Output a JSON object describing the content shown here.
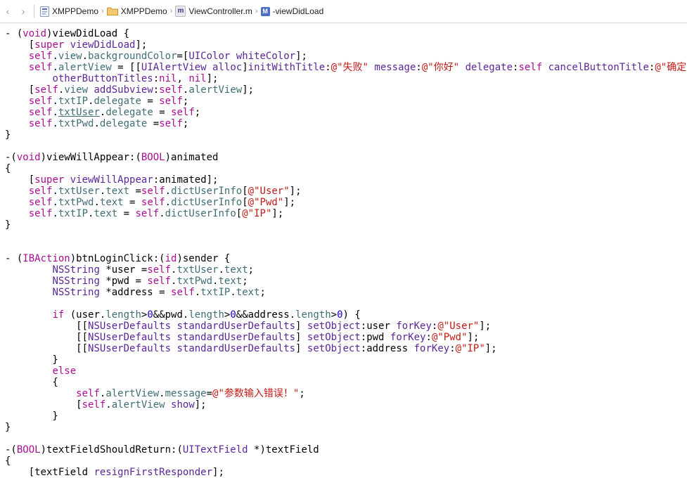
{
  "jumpbar": {
    "back_glyph": "‹",
    "forward_glyph": "›",
    "crumbs": [
      {
        "label": "XMPPDemo",
        "icon": "project-icon"
      },
      {
        "label": "XMPPDemo",
        "icon": "folder-icon"
      },
      {
        "label": "ViewController.m",
        "icon": "objc-file-icon",
        "glyph": "m"
      },
      {
        "label": "-viewDidLoad",
        "icon": "method-icon",
        "glyph": "M"
      }
    ]
  },
  "colors": {
    "keyword": "#aa0d91",
    "class": "#5c2699",
    "property": "#3f6e74",
    "string": "#c41a16",
    "number": "#1c00cf"
  },
  "code": {
    "lines": [
      [
        [
          "t",
          "- ("
        ],
        [
          "kw",
          "void"
        ],
        [
          "t",
          ")viewDidLoad {"
        ]
      ],
      [
        [
          "t",
          "    ["
        ],
        [
          "kw",
          "super"
        ],
        [
          "t",
          " "
        ],
        [
          "cls",
          "viewDidLoad"
        ],
        [
          "t",
          "];"
        ]
      ],
      [
        [
          "t",
          "    "
        ],
        [
          "kw",
          "self"
        ],
        [
          "t",
          "."
        ],
        [
          "prop",
          "view"
        ],
        [
          "t",
          "."
        ],
        [
          "prop",
          "backgroundColor"
        ],
        [
          "t",
          "=["
        ],
        [
          "cls",
          "UIColor"
        ],
        [
          "t",
          " "
        ],
        [
          "cls",
          "whiteColor"
        ],
        [
          "t",
          "];"
        ]
      ],
      [
        [
          "t",
          "    "
        ],
        [
          "kw",
          "self"
        ],
        [
          "t",
          "."
        ],
        [
          "prop",
          "alertView"
        ],
        [
          "t",
          " = [["
        ],
        [
          "cls",
          "UIAlertView"
        ],
        [
          "t",
          " "
        ],
        [
          "cls",
          "alloc"
        ],
        [
          "t",
          "]"
        ],
        [
          "cls",
          "initWithTitle"
        ],
        [
          "t",
          ":"
        ],
        [
          "str",
          "@\"失败\""
        ],
        [
          "t",
          " "
        ],
        [
          "cls",
          "message"
        ],
        [
          "t",
          ":"
        ],
        [
          "str",
          "@\"你好\""
        ],
        [
          "t",
          " "
        ],
        [
          "cls",
          "delegate"
        ],
        [
          "t",
          ":"
        ],
        [
          "kw",
          "self"
        ],
        [
          "t",
          " "
        ],
        [
          "cls",
          "cancelButtonTitle"
        ],
        [
          "t",
          ":"
        ],
        [
          "str",
          "@\"确定\""
        ]
      ],
      [
        [
          "t",
          "        "
        ],
        [
          "cls",
          "otherButtonTitles"
        ],
        [
          "t",
          ":"
        ],
        [
          "kw",
          "nil"
        ],
        [
          "t",
          ", "
        ],
        [
          "kw",
          "nil"
        ],
        [
          "t",
          "];"
        ]
      ],
      [
        [
          "t",
          "    ["
        ],
        [
          "kw",
          "self"
        ],
        [
          "t",
          "."
        ],
        [
          "prop",
          "view"
        ],
        [
          "t",
          " "
        ],
        [
          "cls",
          "addSubview"
        ],
        [
          "t",
          ":"
        ],
        [
          "kw",
          "self"
        ],
        [
          "t",
          "."
        ],
        [
          "prop",
          "alertView"
        ],
        [
          "t",
          "];"
        ]
      ],
      [
        [
          "t",
          "    "
        ],
        [
          "kw",
          "self"
        ],
        [
          "t",
          "."
        ],
        [
          "prop",
          "txtIP"
        ],
        [
          "t",
          "."
        ],
        [
          "prop",
          "delegate"
        ],
        [
          "t",
          " = "
        ],
        [
          "kw",
          "self"
        ],
        [
          "t",
          ";"
        ]
      ],
      [
        [
          "t",
          "    "
        ],
        [
          "kw",
          "self"
        ],
        [
          "t",
          "."
        ],
        [
          "propu",
          "txtUser"
        ],
        [
          "t",
          "."
        ],
        [
          "prop",
          "delegate"
        ],
        [
          "t",
          " = "
        ],
        [
          "kw",
          "self"
        ],
        [
          "t",
          ";"
        ]
      ],
      [
        [
          "t",
          "    "
        ],
        [
          "kw",
          "self"
        ],
        [
          "t",
          "."
        ],
        [
          "prop",
          "txtPwd"
        ],
        [
          "t",
          "."
        ],
        [
          "prop",
          "delegate"
        ],
        [
          "t",
          " ="
        ],
        [
          "kw",
          "self"
        ],
        [
          "t",
          ";"
        ]
      ],
      [
        [
          "t",
          "}"
        ]
      ],
      [],
      [
        [
          "t",
          "-("
        ],
        [
          "kw",
          "void"
        ],
        [
          "t",
          ")viewWillAppear:("
        ],
        [
          "kw",
          "BOOL"
        ],
        [
          "t",
          ")animated"
        ]
      ],
      [
        [
          "t",
          "{"
        ]
      ],
      [
        [
          "t",
          "    ["
        ],
        [
          "kw",
          "super"
        ],
        [
          "t",
          " "
        ],
        [
          "cls",
          "viewWillAppear"
        ],
        [
          "t",
          ":animated];"
        ]
      ],
      [
        [
          "t",
          "    "
        ],
        [
          "kw",
          "self"
        ],
        [
          "t",
          "."
        ],
        [
          "prop",
          "txtUser"
        ],
        [
          "t",
          "."
        ],
        [
          "prop",
          "text"
        ],
        [
          "t",
          " ="
        ],
        [
          "kw",
          "self"
        ],
        [
          "t",
          "."
        ],
        [
          "prop",
          "dictUserInfo"
        ],
        [
          "t",
          "["
        ],
        [
          "str",
          "@\"User\""
        ],
        [
          "t",
          "];"
        ]
      ],
      [
        [
          "t",
          "    "
        ],
        [
          "kw",
          "self"
        ],
        [
          "t",
          "."
        ],
        [
          "prop",
          "txtPwd"
        ],
        [
          "t",
          "."
        ],
        [
          "prop",
          "text"
        ],
        [
          "t",
          " = "
        ],
        [
          "kw",
          "self"
        ],
        [
          "t",
          "."
        ],
        [
          "prop",
          "dictUserInfo"
        ],
        [
          "t",
          "["
        ],
        [
          "str",
          "@\"Pwd\""
        ],
        [
          "t",
          "];"
        ]
      ],
      [
        [
          "t",
          "    "
        ],
        [
          "kw",
          "self"
        ],
        [
          "t",
          "."
        ],
        [
          "prop",
          "txtIP"
        ],
        [
          "t",
          "."
        ],
        [
          "prop",
          "text"
        ],
        [
          "t",
          " = "
        ],
        [
          "kw",
          "self"
        ],
        [
          "t",
          "."
        ],
        [
          "prop",
          "dictUserInfo"
        ],
        [
          "t",
          "["
        ],
        [
          "str",
          "@\"IP\""
        ],
        [
          "t",
          "];"
        ]
      ],
      [
        [
          "t",
          "}"
        ]
      ],
      [],
      [],
      [
        [
          "t",
          "- ("
        ],
        [
          "kw",
          "IBAction"
        ],
        [
          "t",
          ")btnLoginClick:("
        ],
        [
          "kw",
          "id"
        ],
        [
          "t",
          ")sender {"
        ]
      ],
      [
        [
          "t",
          "        "
        ],
        [
          "cls",
          "NSString"
        ],
        [
          "t",
          " *user ="
        ],
        [
          "kw",
          "self"
        ],
        [
          "t",
          "."
        ],
        [
          "prop",
          "txtUser"
        ],
        [
          "t",
          "."
        ],
        [
          "prop",
          "text"
        ],
        [
          "t",
          ";"
        ]
      ],
      [
        [
          "t",
          "        "
        ],
        [
          "cls",
          "NSString"
        ],
        [
          "t",
          " *pwd = "
        ],
        [
          "kw",
          "self"
        ],
        [
          "t",
          "."
        ],
        [
          "prop",
          "txtPwd"
        ],
        [
          "t",
          "."
        ],
        [
          "prop",
          "text"
        ],
        [
          "t",
          ";"
        ]
      ],
      [
        [
          "t",
          "        "
        ],
        [
          "cls",
          "NSString"
        ],
        [
          "t",
          " *address = "
        ],
        [
          "kw",
          "self"
        ],
        [
          "t",
          "."
        ],
        [
          "prop",
          "txtIP"
        ],
        [
          "t",
          "."
        ],
        [
          "prop",
          "text"
        ],
        [
          "t",
          ";"
        ]
      ],
      [],
      [
        [
          "t",
          "        "
        ],
        [
          "kw",
          "if"
        ],
        [
          "t",
          " (user."
        ],
        [
          "prop",
          "length"
        ],
        [
          "t",
          ">"
        ],
        [
          "num",
          "0"
        ],
        [
          "t",
          "&&pwd."
        ],
        [
          "prop",
          "length"
        ],
        [
          "t",
          ">"
        ],
        [
          "num",
          "0"
        ],
        [
          "t",
          "&&address."
        ],
        [
          "prop",
          "length"
        ],
        [
          "t",
          ">"
        ],
        [
          "num",
          "0"
        ],
        [
          "t",
          ") {"
        ]
      ],
      [
        [
          "t",
          "            [["
        ],
        [
          "cls",
          "NSUserDefaults"
        ],
        [
          "t",
          " "
        ],
        [
          "cls",
          "standardUserDefaults"
        ],
        [
          "t",
          "] "
        ],
        [
          "cls",
          "setObject"
        ],
        [
          "t",
          ":user "
        ],
        [
          "cls",
          "forKey"
        ],
        [
          "t",
          ":"
        ],
        [
          "str",
          "@\"User\""
        ],
        [
          "t",
          "];"
        ]
      ],
      [
        [
          "t",
          "            [["
        ],
        [
          "cls",
          "NSUserDefaults"
        ],
        [
          "t",
          " "
        ],
        [
          "cls",
          "standardUserDefaults"
        ],
        [
          "t",
          "] "
        ],
        [
          "cls",
          "setObject"
        ],
        [
          "t",
          ":pwd "
        ],
        [
          "cls",
          "forKey"
        ],
        [
          "t",
          ":"
        ],
        [
          "str",
          "@\"Pwd\""
        ],
        [
          "t",
          "];"
        ]
      ],
      [
        [
          "t",
          "            [["
        ],
        [
          "cls",
          "NSUserDefaults"
        ],
        [
          "t",
          " "
        ],
        [
          "cls",
          "standardUserDefaults"
        ],
        [
          "t",
          "] "
        ],
        [
          "cls",
          "setObject"
        ],
        [
          "t",
          ":address "
        ],
        [
          "cls",
          "forKey"
        ],
        [
          "t",
          ":"
        ],
        [
          "str",
          "@\"IP\""
        ],
        [
          "t",
          "];"
        ]
      ],
      [
        [
          "t",
          "        }"
        ]
      ],
      [
        [
          "t",
          "        "
        ],
        [
          "kw",
          "else"
        ]
      ],
      [
        [
          "t",
          "        {"
        ]
      ],
      [
        [
          "t",
          "            "
        ],
        [
          "kw",
          "self"
        ],
        [
          "t",
          "."
        ],
        [
          "prop",
          "alertView"
        ],
        [
          "t",
          "."
        ],
        [
          "prop",
          "message"
        ],
        [
          "t",
          "="
        ],
        [
          "str",
          "@\"参数输入错误！\""
        ],
        [
          "t",
          ";"
        ]
      ],
      [
        [
          "t",
          "            ["
        ],
        [
          "kw",
          "self"
        ],
        [
          "t",
          "."
        ],
        [
          "prop",
          "alertView"
        ],
        [
          "t",
          " "
        ],
        [
          "cls",
          "show"
        ],
        [
          "t",
          "];"
        ]
      ],
      [
        [
          "t",
          "        }"
        ]
      ],
      [
        [
          "t",
          "}"
        ]
      ],
      [],
      [
        [
          "t",
          "-("
        ],
        [
          "kw",
          "BOOL"
        ],
        [
          "t",
          ")textFieldShouldReturn:("
        ],
        [
          "cls",
          "UITextField"
        ],
        [
          "t",
          " *)textField"
        ]
      ],
      [
        [
          "t",
          "{"
        ]
      ],
      [
        [
          "t",
          "    [textField "
        ],
        [
          "cls",
          "resignFirstResponder"
        ],
        [
          "t",
          "];"
        ]
      ]
    ]
  }
}
